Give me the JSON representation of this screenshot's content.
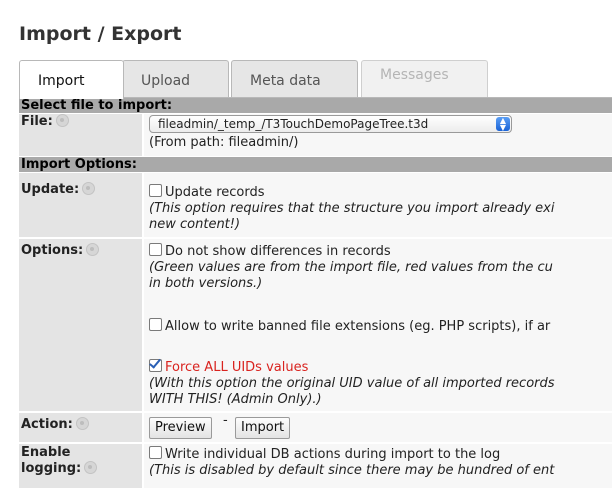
{
  "page": {
    "title": "Import / Export"
  },
  "tabs": [
    {
      "label": "Import",
      "state": "active"
    },
    {
      "label": "Upload",
      "state": "normal"
    },
    {
      "label": "Meta data",
      "state": "normal"
    },
    {
      "label": "Messages",
      "state": "disabled"
    }
  ],
  "sections": {
    "select_file": "Select file to import:",
    "import_options": "Import Options:"
  },
  "file_row": {
    "label": "File:",
    "selected_file": "fileadmin/_temp_/T3TouchDemoPageTree.t3d",
    "from_path": "(From path: fileadmin/)"
  },
  "update_row": {
    "label": "Update:",
    "checkbox_label": "Update records",
    "checked": false,
    "note_line1": "(This option requires that the structure you import already exi",
    "note_line2": "new content!)"
  },
  "options_row": {
    "label": "Options:",
    "no_diff": {
      "label": "Do not show differences in records",
      "checked": false,
      "note_line1": "(Green values are from the import file, red values from the cu",
      "note_line2": "in both versions.)"
    },
    "banned_ext": {
      "label": "Allow to write banned file extensions (eg. PHP scripts), if ar",
      "checked": false
    },
    "force_uids": {
      "label": "Force ALL UIDs values",
      "checked": true,
      "note_line1": "(With this option the original UID value of all imported records",
      "note_line2": "WITH THIS! (Admin Only).)"
    }
  },
  "action_row": {
    "label": "Action:",
    "preview_button": "Preview",
    "separator": "-",
    "import_button": "Import"
  },
  "logging_row": {
    "label_line1": "Enable",
    "label_line2": "logging:",
    "checkbox_label": "Write individual DB actions during import to the log",
    "checked": false,
    "note": "(This is disabled by default since there may be hundred of ent"
  },
  "colors": {
    "section_bar": "#a9a9a9",
    "label_column": "#e4e4e4",
    "warning_text": "#d9231f",
    "select_arrow": "#1a63d6"
  }
}
